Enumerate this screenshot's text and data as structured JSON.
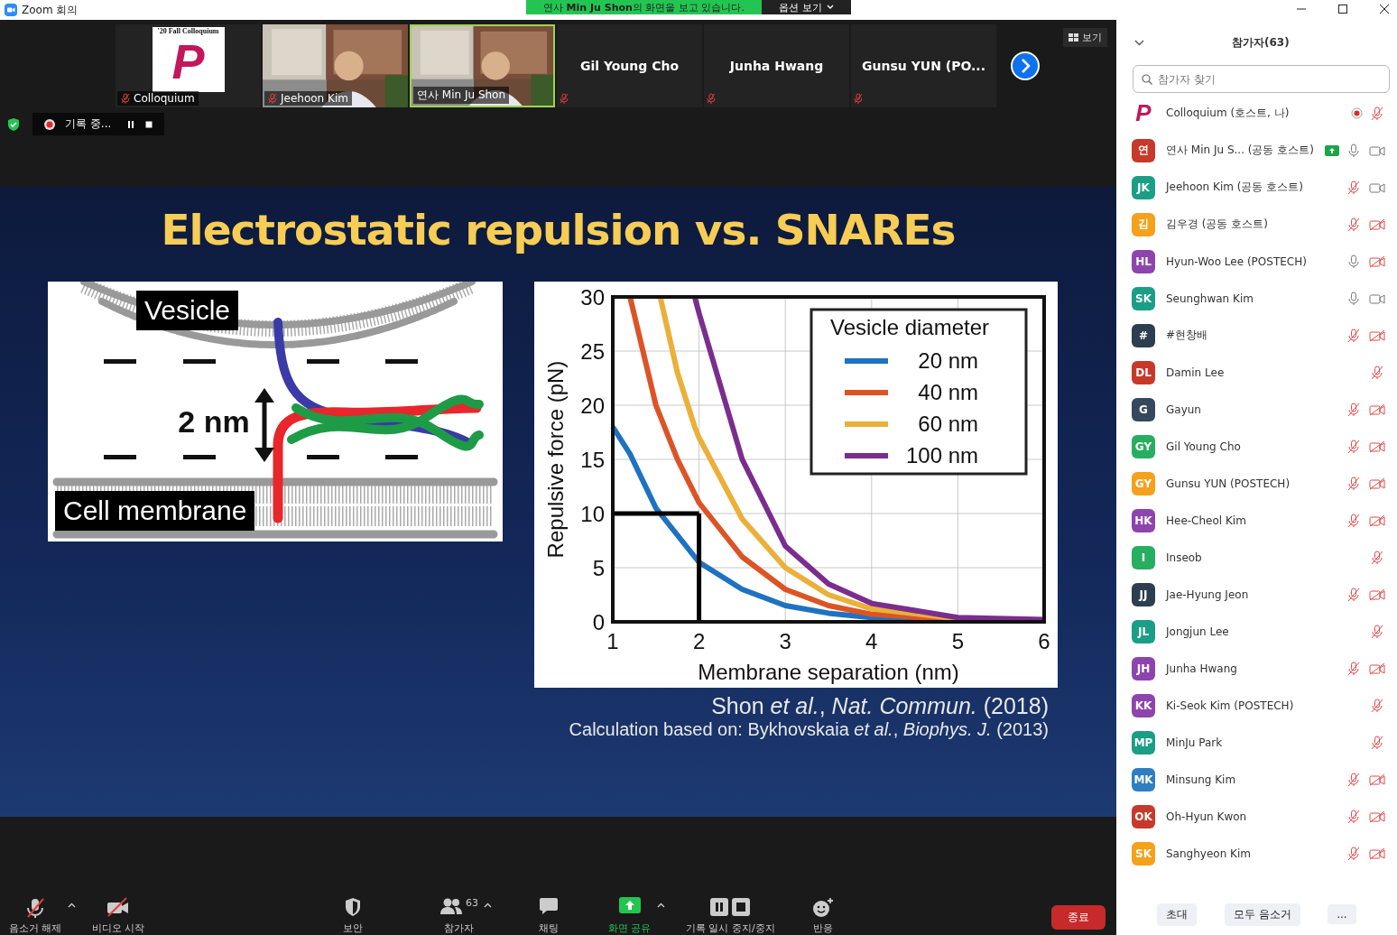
{
  "window": {
    "title": "Zoom 회의"
  },
  "banner": {
    "text": "연사 **Min Ju Shon**의 화면을 보고 있습니다.",
    "button": "옵션 보기"
  },
  "tiles": [
    {
      "kind": "logo",
      "logo_caption": "'20 Fall Colloquium",
      "logo_letter": "P",
      "name": "Colloquium",
      "muted": true,
      "selected": false
    },
    {
      "kind": "video",
      "name": "Jeehoon Kim",
      "muted": true,
      "selected": false
    },
    {
      "kind": "video",
      "name": "연사 Min Ju Shon",
      "muted": false,
      "selected": true
    },
    {
      "kind": "name",
      "name": "Gil Young Cho",
      "muted": true,
      "selected": false
    },
    {
      "kind": "name",
      "name": "Junha Hwang",
      "muted": true,
      "selected": false
    },
    {
      "kind": "name",
      "name": "Gunsu YUN (PO...",
      "muted": true,
      "selected": false
    }
  ],
  "view_button": "보기",
  "recording": {
    "label": "기록 중..."
  },
  "slide": {
    "title": "Electrostatic repulsion vs. SNAREs",
    "diagram": {
      "vesicle_label": "Vesicle",
      "membrane_label": "Cell membrane",
      "gap_label": "2 nm"
    },
    "chart_data": {
      "type": "line",
      "xlabel": "Membrane separation (nm)",
      "ylabel": "Repulsive force (pN)",
      "x": [
        1,
        1.2,
        1.5,
        1.55,
        1.75,
        1.95,
        2,
        2.5,
        3,
        3.5,
        4,
        5,
        6
      ],
      "series": [
        {
          "name": "20 nm",
          "color": "#1f72c0",
          "values": [
            18,
            15.5,
            10.5,
            10,
            8,
            6,
            5.5,
            3,
            1.5,
            0.8,
            0.4,
            0.1,
            0.1
          ]
        },
        {
          "name": "40 nm",
          "color": "#dc5426",
          "values": [
            null,
            30,
            20,
            19,
            15,
            11.8,
            11,
            6,
            3,
            1.5,
            0.7,
            0.2,
            0.1
          ]
        },
        {
          "name": "60 nm",
          "color": "#eab03a",
          "values": [
            null,
            null,
            null,
            30,
            23,
            18,
            17,
            9.5,
            5,
            2.5,
            1.2,
            0.3,
            null
          ]
        },
        {
          "name": "100 nm",
          "color": "#7b2d8e",
          "values": [
            null,
            null,
            null,
            null,
            null,
            30,
            28.5,
            15,
            7,
            3.5,
            1.7,
            0.4,
            0.2
          ]
        }
      ],
      "xlim": [
        1,
        6
      ],
      "ylim": [
        0,
        30
      ],
      "xticks": [
        1,
        2,
        3,
        4,
        5,
        6
      ],
      "yticks": [
        0,
        5,
        10,
        15,
        20,
        25,
        30
      ],
      "grid": true,
      "legend": {
        "title": "Vesicle diameter"
      },
      "ref_lines": [
        {
          "axis": "y",
          "value": 10
        },
        {
          "axis": "x",
          "value": 2
        }
      ]
    },
    "citation": "Shon *et al.*, *Nat. Commun.* (2018)",
    "source": "Calculation based on: Bykhovskaia *et al.*, *Biophys. J.* (2013)"
  },
  "toolbar": [
    {
      "kind": "mic",
      "label": "음소거 해제",
      "caret": true
    },
    {
      "kind": "video",
      "label": "비디오 시작",
      "caret": false
    },
    {
      "kind": "security",
      "label": "보안",
      "caret": false
    },
    {
      "kind": "participants",
      "label": "참가자",
      "count": "63",
      "caret": true
    },
    {
      "kind": "chat",
      "label": "채팅",
      "caret": false
    },
    {
      "kind": "share",
      "label": "화면 공유",
      "caret": true
    },
    {
      "kind": "record",
      "label": "기록 일시 중지/중지",
      "caret": false
    },
    {
      "kind": "reactions",
      "label": "반응",
      "caret": false
    }
  ],
  "end_button": "종료",
  "panel": {
    "title": "참가자(63)",
    "search": {
      "placeholder": "참가자 찾기"
    },
    "participants": [
      {
        "avatar": "P",
        "kind": "logo",
        "color": "#c2185b",
        "name": "Colloquium (호스트, 나)",
        "recording": true,
        "muted": true
      },
      {
        "avatar": "연",
        "kind": "initials",
        "color": "#c7392b",
        "name": "연사 Min Ju S... (공동 호스트)",
        "sharing": true,
        "muted": false,
        "video_off": false
      },
      {
        "avatar": "JK",
        "kind": "initials",
        "color": "#1a9e87",
        "name": "Jeehoon Kim (공동 호스트)",
        "muted": true,
        "video_off": false
      },
      {
        "avatar": "김",
        "kind": "initials",
        "color": "#f5a11c",
        "name": "김우경 (공동 호스트)",
        "muted": true,
        "video_off": true
      },
      {
        "avatar": "HL",
        "kind": "initials",
        "color": "#8e44ad",
        "name": "Hyun-Woo Lee (POSTECH)",
        "muted": false,
        "video_off": true
      },
      {
        "avatar": "SK",
        "kind": "initials",
        "color": "#1a9e87",
        "name": "Seunghwan Kim",
        "muted": false,
        "video_off": false
      },
      {
        "avatar": "#",
        "kind": "initials",
        "color": "#2c3e50",
        "name": "#현창배",
        "muted": true,
        "video_off": true
      },
      {
        "avatar": "DL",
        "kind": "initials",
        "color": "#c7392b",
        "name": "Damin Lee",
        "muted": true
      },
      {
        "avatar": "G",
        "kind": "initials",
        "color": "#34495e",
        "name": "Gayun",
        "muted": true,
        "video_off": true
      },
      {
        "avatar": "GY",
        "kind": "initials",
        "color": "#27ae60",
        "name": "Gil Young Cho",
        "muted": true,
        "video_off": true
      },
      {
        "avatar": "GY",
        "kind": "initials",
        "color": "#f5a11c",
        "name": "Gunsu YUN (POSTECH)",
        "muted": true,
        "video_off": true
      },
      {
        "avatar": "HK",
        "kind": "initials",
        "color": "#8e44ad",
        "name": "Hee-Cheol Kim",
        "muted": true,
        "video_off": true
      },
      {
        "avatar": "I",
        "kind": "initials",
        "color": "#27ae60",
        "name": "Inseob",
        "muted": true
      },
      {
        "avatar": "JJ",
        "kind": "initials",
        "color": "#2c3e50",
        "name": "Jae-Hyung Jeon",
        "muted": true,
        "video_off": true
      },
      {
        "avatar": "JL",
        "kind": "initials",
        "color": "#1a9e87",
        "name": "Jongjun Lee",
        "muted": true
      },
      {
        "avatar": "JH",
        "kind": "initials",
        "color": "#8e44ad",
        "name": "Junha Hwang",
        "muted": true,
        "video_off": true
      },
      {
        "avatar": "KK",
        "kind": "initials",
        "color": "#8e44ad",
        "name": "Ki-Seok Kim (POSTECH)",
        "muted": true
      },
      {
        "avatar": "MP",
        "kind": "initials",
        "color": "#1a9e87",
        "name": "MinJu Park",
        "muted": true
      },
      {
        "avatar": "MK",
        "kind": "initials",
        "color": "#2e7fc1",
        "name": "Minsung Kim",
        "muted": true,
        "video_off": true
      },
      {
        "avatar": "OK",
        "kind": "initials",
        "color": "#c7392b",
        "name": "Oh-Hyun Kwon",
        "muted": true,
        "video_off": true
      },
      {
        "avatar": "SK",
        "kind": "initials",
        "color": "#f5a11c",
        "name": "Sanghyeon Kim",
        "muted": true,
        "video_off": true
      }
    ],
    "footer": [
      "초대",
      "모두 음소거",
      "..."
    ]
  }
}
